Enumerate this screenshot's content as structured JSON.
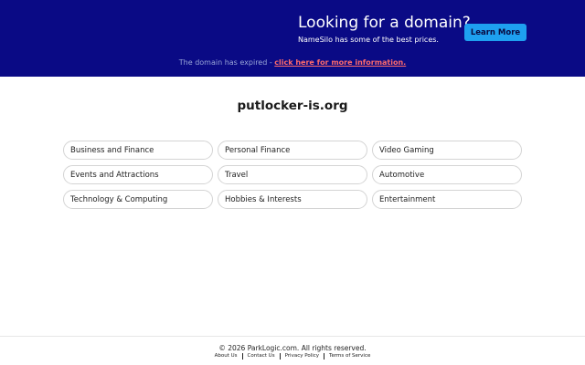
{
  "banner": {
    "title": "Looking for a domain?",
    "subtitle": "NameSilo has some of the best prices.",
    "button_label": "Learn More",
    "expired_text": "The domain has expired - ",
    "expired_link": "click here for more information.",
    "background_color": "#0a0a85",
    "button_color": "#1ea0f0",
    "link_color": "#ff6b6b"
  },
  "domain": "putlocker-is.org",
  "categories": [
    "Business and Finance",
    "Personal Finance",
    "Video Gaming",
    "Events and Attractions",
    "Travel",
    "Automotive",
    "Technology & Computing",
    "Hobbies & Interests",
    "Entertainment"
  ],
  "footer": {
    "copyright": "© 2026 ParkLogic.com. All rights reserved.",
    "links": [
      "About Us",
      "Contact Us",
      "Privacy Policy",
      "Terms of Service"
    ]
  }
}
